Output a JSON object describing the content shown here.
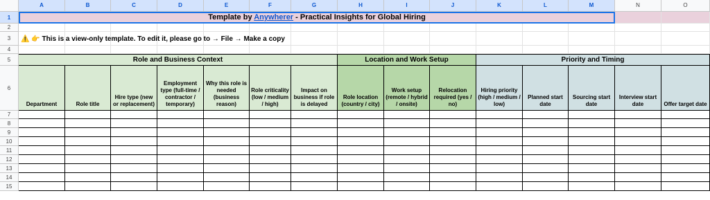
{
  "columns": [
    "A",
    "B",
    "C",
    "D",
    "E",
    "F",
    "G",
    "H",
    "I",
    "J",
    "K",
    "L",
    "M",
    "N",
    "O"
  ],
  "rows": [
    "1",
    "2",
    "3",
    "4",
    "5",
    "6",
    "7",
    "8",
    "9",
    "10",
    "11",
    "12",
    "13",
    "14",
    "15"
  ],
  "title": {
    "prefix": "Template by ",
    "link": "Anywherer",
    "suffix": " - Practical Insights for Global Hiring"
  },
  "notice": {
    "icons": "⚠️ 👉",
    "text": "This is a view-only template. To edit it, please go to → File → Make a copy"
  },
  "sections": [
    {
      "label": "Role and Business Context"
    },
    {
      "label": "Location and Work Setup"
    },
    {
      "label": "Priority and Timing"
    }
  ],
  "headers": [
    "Department",
    "Role title",
    "Hire type (new or replacement)",
    "Employment type (full-time / contractor / temporary)",
    "Why this role is needed (business reason)",
    "Role criticality (low / medium / high)",
    "Impact on business if role is delayed",
    "Role location (country / city)",
    "Work setup (remote / hybrid / onsite)",
    "Relocation required (yes / no)",
    "Hiring priority (high / medium / low)",
    "Planned start date",
    "Sourcing start date",
    "Interview start date",
    "Offer target date"
  ],
  "colors": {
    "title_bg": "#ead1dc",
    "context_bg": "#d9ead3",
    "location_bg": "#b6d7a8",
    "timing_bg": "#d0e0e3",
    "selection": "#1a73e8"
  }
}
